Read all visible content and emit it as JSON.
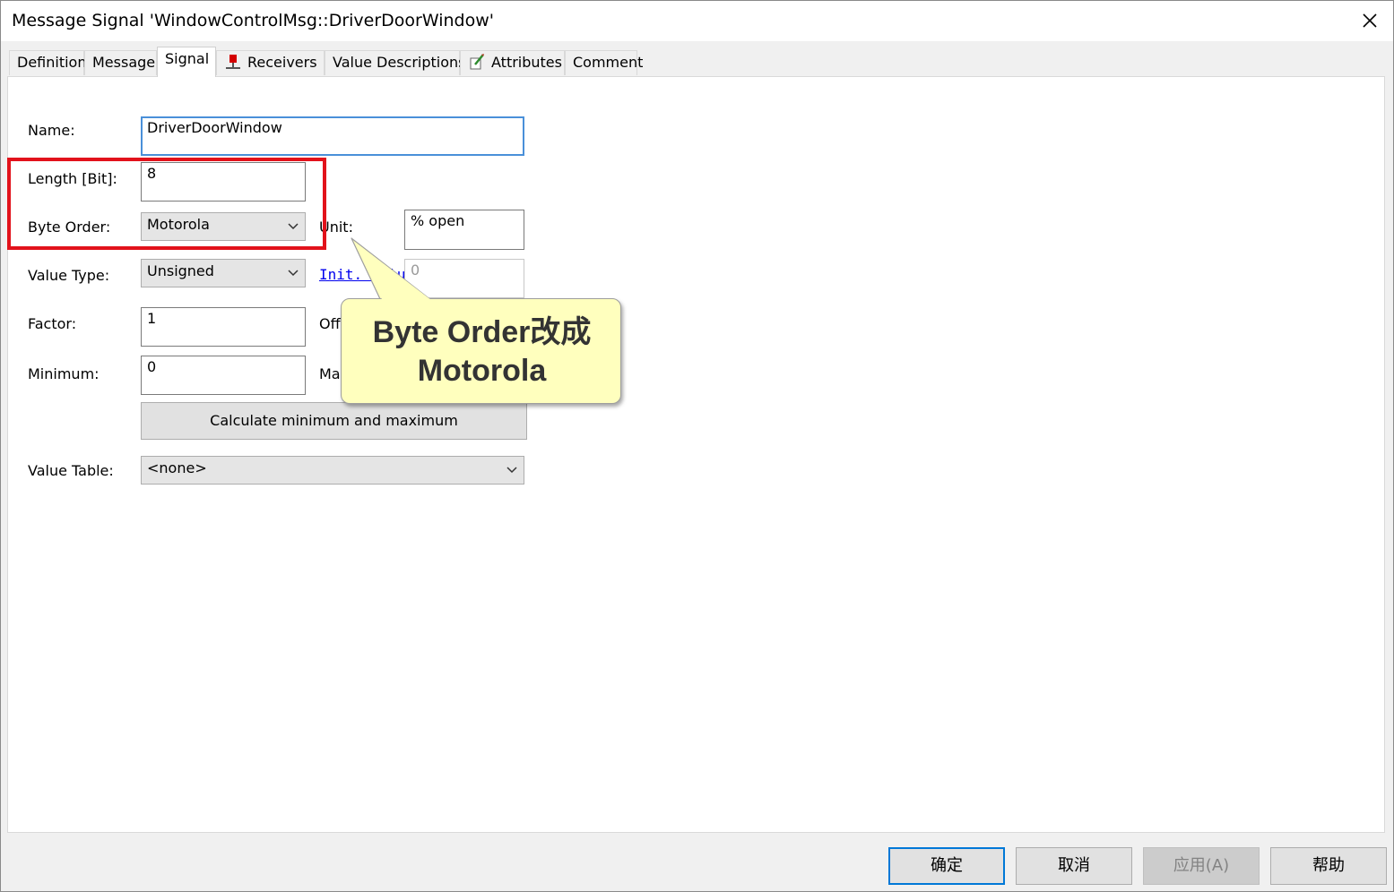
{
  "window": {
    "title": "Message Signal 'WindowControlMsg::DriverDoorWindow'"
  },
  "tabs": [
    {
      "label": "Definition"
    },
    {
      "label": "Message"
    },
    {
      "label": "Signal"
    },
    {
      "label": "Receivers",
      "icon": "receivers-icon"
    },
    {
      "label": "Value Descriptions"
    },
    {
      "label": "Attributes",
      "icon": "attributes-icon"
    },
    {
      "label": "Comment"
    }
  ],
  "form": {
    "name_label": "Name:",
    "name_value": "DriverDoorWindow",
    "length_label": "Length [Bit]:",
    "length_value": "8",
    "byte_order_label": "Byte Order:",
    "byte_order_value": "Motorola",
    "unit_label": "Unit:",
    "unit_value": "% open",
    "value_type_label": "Value Type:",
    "value_type_value": "Unsigned",
    "init_value_label": "Init. Value",
    "init_value_value": "0",
    "factor_label": "Factor:",
    "factor_value": "1",
    "offset_label": "Offset:",
    "minimum_label": "Minimum:",
    "minimum_value": "0",
    "maximum_label": "Maximum:",
    "calc_button": "Calculate minimum and maximum",
    "value_table_label": "Value Table:",
    "value_table_value": "<none>"
  },
  "callout": {
    "line1": "Byte Order改成",
    "line2": "Motorola"
  },
  "footer": {
    "ok": "确定",
    "cancel": "取消",
    "apply": "应用(A)",
    "help": "帮助"
  },
  "colors": {
    "highlight": "#e2121b",
    "callout_bg": "#ffffbe",
    "focus": "#4a90d9",
    "default_button": "#0078d7"
  }
}
